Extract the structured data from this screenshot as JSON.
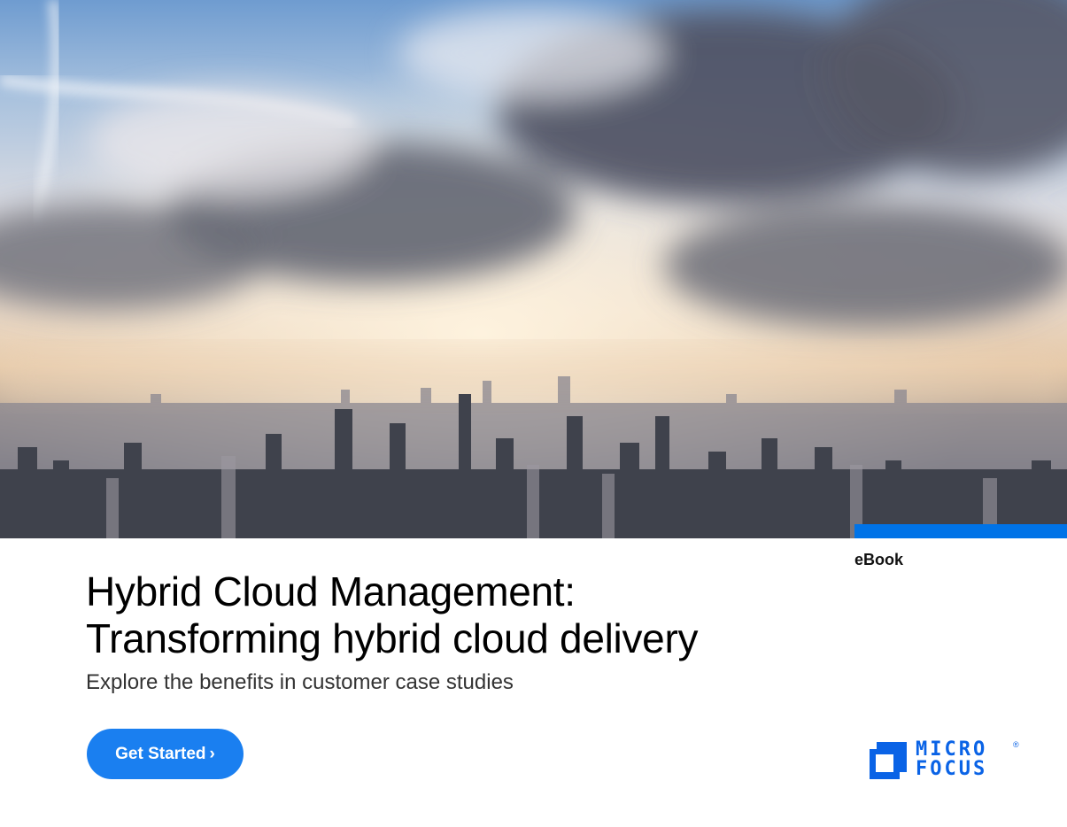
{
  "hero": {
    "image": "aerial city skyline under clouds"
  },
  "label": "eBook",
  "title_line1": "Hybrid Cloud Management:",
  "title_line2": "Transforming hybrid cloud delivery",
  "subtitle": "Explore the benefits in customer case studies",
  "cta": {
    "label": "Get Started",
    "chevron": "›"
  },
  "logo": {
    "line1": "MICRO",
    "line2": "FOCUS",
    "registered": "®"
  },
  "colors": {
    "brand_blue": "#0073e7",
    "cta_blue": "#1a7ff0",
    "logo_blue": "#0a63e6"
  }
}
